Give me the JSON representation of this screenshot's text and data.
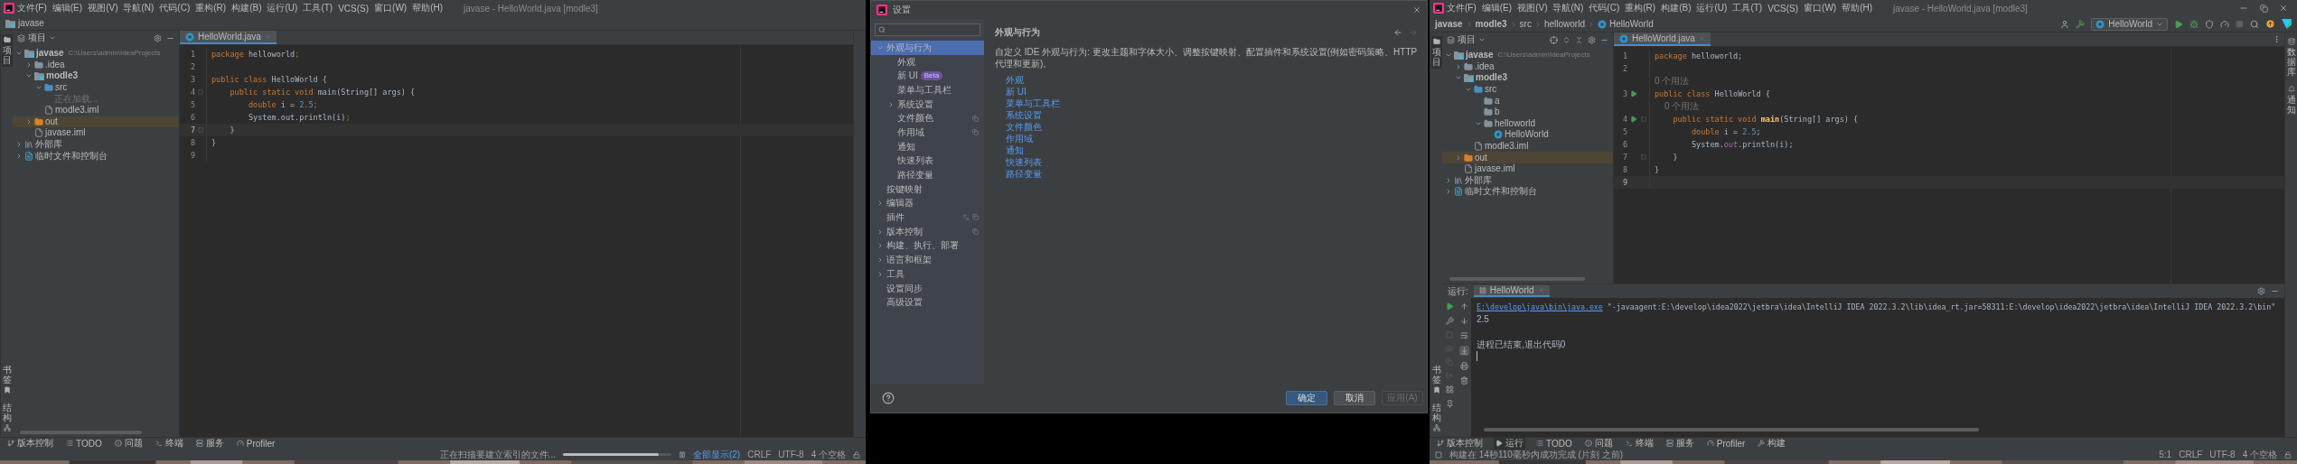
{
  "left_ide": {
    "menu": [
      "文件(F)",
      "编辑(E)",
      "视图(V)",
      "导航(N)",
      "代码(C)",
      "重构(R)",
      "构建(B)",
      "运行(U)",
      "工具(T)",
      "VCS(S)",
      "窗口(W)",
      "帮助(H)"
    ],
    "title": "javase - HelloWorld.java [modle3]",
    "breadcrumb": [
      {
        "label": "javase",
        "kind": "project"
      }
    ],
    "side_tabs_top": [
      {
        "label": "项目",
        "selected": true
      }
    ],
    "side_tabs_bottom": [
      {
        "label": "书签",
        "selected": false
      },
      {
        "label": "结构",
        "selected": false
      }
    ],
    "project_panel": {
      "title": "项目",
      "tree": [
        {
          "label": "javase",
          "kind": "module",
          "note": "C:\\Users\\admin\\IdeaProjects",
          "expanded": true,
          "selected": false,
          "children": [
            {
              "label": ".idea",
              "kind": "folder",
              "expanded": false,
              "selected": false
            },
            {
              "label": "modle3",
              "kind": "module",
              "expanded": true,
              "selected": false,
              "children": [
                {
                  "label": "src",
                  "kind": "source",
                  "expanded": true,
                  "selected": false,
                  "children": [
                    {
                      "label": "正在加载...",
                      "kind": "loading",
                      "selected": false
                    }
                  ]
                },
                {
                  "label": "modle3.iml",
                  "kind": "iml",
                  "selected": false
                }
              ]
            },
            {
              "label": "out",
              "kind": "excluded",
              "expanded": false,
              "selected": true
            },
            {
              "label": "javase.iml",
              "kind": "iml",
              "selected": false
            }
          ]
        },
        {
          "label": "外部库",
          "kind": "library",
          "expanded": false,
          "selected": false
        },
        {
          "label": "临时文件和控制台",
          "kind": "scratch",
          "expanded": false,
          "selected": false
        }
      ]
    },
    "editor_tabs": [
      {
        "label": "HelloWorld.java",
        "selected": true
      }
    ],
    "code": [
      {
        "kind": "code",
        "number": "1",
        "current": false,
        "fold": false,
        "tokens": [
          {
            "kind": "keyword",
            "text": "package"
          },
          {
            "kind": "plain",
            "text": " helloworld"
          },
          {
            "kind": "semicolon",
            "text": ";"
          }
        ]
      },
      {
        "kind": "code",
        "number": "2",
        "current": false,
        "fold": false
      },
      {
        "kind": "code",
        "number": "3",
        "current": false,
        "fold": false,
        "tokens": [
          {
            "kind": "keyword",
            "text": "public class"
          },
          {
            "kind": "plain",
            "text": " HelloWorld {"
          }
        ]
      },
      {
        "kind": "code",
        "number": "4",
        "current": false,
        "fold": true,
        "tokens": [
          {
            "kind": "keyword",
            "text": "    public static void"
          },
          {
            "kind": "plain",
            "text": " main(String[] args) {"
          }
        ]
      },
      {
        "kind": "code",
        "number": "5",
        "current": false,
        "fold": false,
        "tokens": [
          {
            "kind": "keyword",
            "text": "        double"
          },
          {
            "kind": "plain",
            "text": " i = "
          },
          {
            "kind": "number",
            "text": "2.5"
          },
          {
            "kind": "semicolon",
            "text": ";"
          }
        ]
      },
      {
        "kind": "code",
        "number": "6",
        "current": false,
        "fold": false,
        "tokens": [
          {
            "kind": "plain",
            "text": "        System.out.println(i)"
          },
          {
            "kind": "semicolon",
            "text": ";"
          }
        ]
      },
      {
        "kind": "code",
        "number": "7",
        "current": true,
        "fold": true,
        "tokens": [
          {
            "kind": "plain",
            "text": "    }"
          }
        ]
      },
      {
        "kind": "code",
        "number": "8",
        "current": false,
        "fold": false,
        "tokens": [
          {
            "kind": "plain",
            "text": "}"
          }
        ]
      },
      {
        "kind": "code",
        "number": "9",
        "current": false,
        "fold": false
      }
    ],
    "tool_buttons": [
      {
        "label": "版本控制",
        "kind": "vcs",
        "selected": false
      },
      {
        "label": "TODO",
        "kind": "todo",
        "selected": false
      },
      {
        "label": "问题",
        "kind": "problems",
        "selected": false
      },
      {
        "label": "终端",
        "kind": "terminal",
        "selected": false
      },
      {
        "label": "服务",
        "kind": "services",
        "selected": false
      },
      {
        "label": "Profiler",
        "kind": "profiler",
        "selected": false
      }
    ],
    "status": {
      "message": "正在扫描要建立索引的文件...",
      "progress": {
        "level": 0.88
      },
      "link": "全部显示(2)",
      "items": [
        "CRLF",
        "UTF-8",
        "4 个空格"
      ]
    }
  },
  "settings_dialog": {
    "title": "设置",
    "nav": [
      {
        "label": "外观与行为",
        "expanded": true,
        "selected": true,
        "children": [
          {
            "label": "外观",
            "selected": false
          },
          {
            "label": "新 UI",
            "badge": "Beta",
            "selected": false
          },
          {
            "label": "菜单与工具栏",
            "selected": false
          },
          {
            "label": "系统设置",
            "expanded": false,
            "selected": false
          },
          {
            "label": "文件颜色",
            "project_level": true,
            "selected": false
          },
          {
            "label": "作用域",
            "project_level": true,
            "selected": false
          },
          {
            "label": "通知",
            "selected": false
          },
          {
            "label": "快速列表",
            "selected": false
          },
          {
            "label": "路径变量",
            "selected": false
          }
        ]
      },
      {
        "label": "按键映射",
        "selected": false
      },
      {
        "label": "编辑器",
        "expanded": false,
        "selected": false
      },
      {
        "label": "插件",
        "project_level": true,
        "extra_icon": true,
        "selected": false
      },
      {
        "label": "版本控制",
        "expanded": false,
        "project_level": true,
        "selected": false
      },
      {
        "label": "构建、执行、部署",
        "expanded": false,
        "selected": false
      },
      {
        "label": "语言和框架",
        "expanded": false,
        "selected": false
      },
      {
        "label": "工具",
        "expanded": false,
        "selected": false
      },
      {
        "label": "设置同步",
        "selected": false
      },
      {
        "label": "高级设置",
        "selected": false
      }
    ],
    "heading": "外观与行为",
    "description": "自定义 IDE 外观与行为: 更改主题和字体大小、调整按键映射、配置插件和系统设置(例如密码策略、HTTP 代理和更新)。",
    "links": [
      "外观",
      "新 UI",
      "菜单与工具栏",
      "系统设置",
      "文件颜色",
      "作用域",
      "通知",
      "快速列表",
      "路径变量"
    ],
    "buttons": [
      {
        "label": "确定",
        "kind": "primary",
        "disabled": false
      },
      {
        "label": "取消",
        "kind": "default",
        "disabled": false
      },
      {
        "label": "应用(A)",
        "kind": "default",
        "disabled": true
      }
    ]
  },
  "right_ide": {
    "menu": [
      "文件(F)",
      "编辑(E)",
      "视图(V)",
      "导航(N)",
      "代码(C)",
      "重构(R)",
      "构建(B)",
      "运行(U)",
      "工具(T)",
      "VCS(S)",
      "窗口(W)",
      "帮助(H)"
    ],
    "title": "javase - HelloWorld.java [modle3]",
    "breadcrumb": [
      {
        "label": "javase",
        "kind": "project"
      },
      {
        "label": "modle3",
        "kind": "module"
      },
      {
        "label": "src",
        "kind": "folder"
      },
      {
        "label": "helloworld",
        "kind": "folder"
      },
      {
        "label": "HelloWorld",
        "kind": "class"
      }
    ],
    "run_config": "HelloWorld",
    "side_tabs_top": [
      {
        "label": "项目",
        "selected": true
      }
    ],
    "side_tabs_bottom": [
      {
        "label": "书签",
        "selected": false
      },
      {
        "label": "结构",
        "selected": false
      }
    ],
    "side_tabs_right": [
      {
        "label": "数据库",
        "selected": false
      },
      {
        "label": "通知",
        "selected": false
      }
    ],
    "project_panel": {
      "title": "项目",
      "tree": [
        {
          "label": "javase",
          "kind": "module",
          "note": "C:\\Users\\admin\\IdeaProjects",
          "expanded": true,
          "selected": false,
          "children": [
            {
              "label": ".idea",
              "kind": "folder",
              "expanded": false,
              "selected": false
            },
            {
              "label": "modle3",
              "kind": "module",
              "expanded": true,
              "selected": false,
              "children": [
                {
                  "label": "src",
                  "kind": "source",
                  "expanded": true,
                  "selected": false,
                  "children": [
                    {
                      "label": "a",
                      "kind": "package",
                      "selected": false
                    },
                    {
                      "label": "b",
                      "kind": "package",
                      "selected": false
                    },
                    {
                      "label": "helloworld",
                      "kind": "package",
                      "expanded": true,
                      "selected": false,
                      "children": [
                        {
                          "label": "HelloWorld",
                          "kind": "class",
                          "selected": false
                        }
                      ]
                    }
                  ]
                },
                {
                  "label": "modle3.iml",
                  "kind": "iml",
                  "selected": false
                }
              ]
            },
            {
              "label": "out",
              "kind": "excluded",
              "expanded": false,
              "selected": true
            },
            {
              "label": "javase.iml",
              "kind": "iml",
              "selected": false
            }
          ]
        },
        {
          "label": "外部库",
          "kind": "library",
          "expanded": false,
          "selected": false
        },
        {
          "label": "临时文件和控制台",
          "kind": "scratch",
          "expanded": false,
          "selected": false
        }
      ]
    },
    "editor_tabs": [
      {
        "label": "HelloWorld.java",
        "selected": true
      }
    ],
    "code": [
      {
        "kind": "code",
        "number": "1",
        "current": false,
        "fold": false,
        "runnable": false,
        "tokens": [
          {
            "kind": "keyword",
            "text": "package"
          },
          {
            "kind": "plain",
            "text": " helloworld;"
          }
        ]
      },
      {
        "kind": "code",
        "number": "2",
        "current": false,
        "fold": false,
        "runnable": false
      },
      {
        "kind": "hint",
        "text": "0 个用法"
      },
      {
        "kind": "code",
        "number": "3",
        "current": false,
        "fold": false,
        "runnable": true,
        "tokens": [
          {
            "kind": "keyword",
            "text": "public class"
          },
          {
            "kind": "plain",
            "text": " HelloWorld {"
          }
        ]
      },
      {
        "kind": "hint",
        "text": "    0 个用法"
      },
      {
        "kind": "code",
        "number": "4",
        "current": false,
        "fold": true,
        "runnable": true,
        "tokens": [
          {
            "kind": "keyword",
            "text": "    public static void "
          },
          {
            "kind": "method",
            "text": "main"
          },
          {
            "kind": "plain",
            "text": "(String[] args) {"
          }
        ]
      },
      {
        "kind": "code",
        "number": "5",
        "current": false,
        "fold": false,
        "runnable": false,
        "tokens": [
          {
            "kind": "keyword",
            "text": "        double"
          },
          {
            "kind": "plain",
            "text": " i = "
          },
          {
            "kind": "number",
            "text": "2.5"
          },
          {
            "kind": "plain",
            "text": ";"
          }
        ]
      },
      {
        "kind": "code",
        "number": "6",
        "current": false,
        "fold": false,
        "runnable": false,
        "tokens": [
          {
            "kind": "plain",
            "text": "        System."
          },
          {
            "kind": "field",
            "text": "out"
          },
          {
            "kind": "plain",
            "text": ".println(i);"
          }
        ]
      },
      {
        "kind": "code",
        "number": "7",
        "current": false,
        "fold": true,
        "runnable": false,
        "tokens": [
          {
            "kind": "plain",
            "text": "    }"
          }
        ]
      },
      {
        "kind": "code",
        "number": "8",
        "current": false,
        "fold": false,
        "runnable": false,
        "tokens": [
          {
            "kind": "plain",
            "text": "}"
          }
        ]
      },
      {
        "kind": "code",
        "number": "9",
        "current": true,
        "fold": false,
        "runnable": false
      }
    ],
    "run_panel": {
      "title": "运行:",
      "tabs": [
        {
          "label": "HelloWorld",
          "selected": true
        }
      ],
      "output": [
        {
          "kind": "command",
          "link": "E:\\develop\\java\\bin\\java.exe",
          "text": " \"-javaagent:E:\\develop\\idea2022\\jetbra\\idea\\IntelliJ IDEA 2022.3.2\\lib\\idea_rt.jar=58311:E:\\develop\\idea2022\\jetbra\\idea\\IntelliJ IDEA 2022.3.2\\bin\""
        },
        {
          "kind": "text",
          "text": "2.5"
        },
        {
          "kind": "blank"
        },
        {
          "kind": "text",
          "text": "进程已结束,退出代码0"
        }
      ]
    },
    "tool_buttons": [
      {
        "label": "版本控制",
        "kind": "vcs",
        "selected": false
      },
      {
        "label": "运行",
        "kind": "run",
        "selected": true
      },
      {
        "label": "TODO",
        "kind": "todo",
        "selected": false
      },
      {
        "label": "问题",
        "kind": "problems",
        "selected": false
      },
      {
        "label": "终端",
        "kind": "terminal",
        "selected": false
      },
      {
        "label": "服务",
        "kind": "services",
        "selected": false
      },
      {
        "label": "Profiler",
        "kind": "profiler",
        "selected": false
      },
      {
        "label": "构建",
        "kind": "build",
        "selected": false
      }
    ],
    "status": {
      "message": "构建在 14秒110毫秒内成功完成 (片刻 之前)",
      "items": [
        "5:1",
        "CRLF",
        "UTF-8",
        "4 个空格"
      ]
    }
  }
}
